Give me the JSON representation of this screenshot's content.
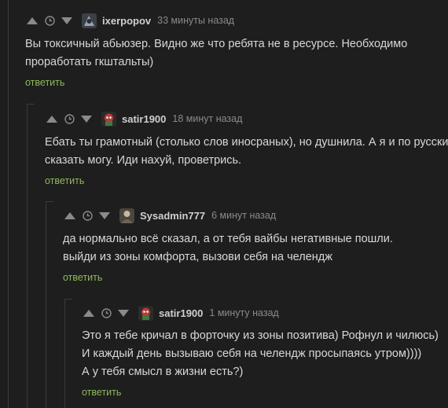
{
  "comments": [
    {
      "user": "ixerpopov",
      "time": "33 минуты назад",
      "lines": [
        "Вы токсичный абьюзер. Видно же что ребята не в ресурсе. Необходимо",
        "проработать гкштальты)"
      ],
      "reply": "ответить"
    },
    {
      "user": "satir1900",
      "time": "18 минут назад",
      "lines": [
        "Ебать ты грамотный (столько слов иносраных), но душнила. А я и по русски",
        "сказать могу. Иди нахуй, проветрись."
      ],
      "reply": "ответить"
    },
    {
      "user": "Sysadmin777",
      "time": "6 минут назад",
      "lines": [
        "да нормально всё сказал, а от тебя вайбы негативные пошли.",
        "выйди из зоны комфорта, вызови себя на челендж"
      ],
      "reply": "ответить"
    },
    {
      "user": "satir1900",
      "time": "1 минуту назад",
      "lines": [
        "Это я тебе кричал в форточку из зоны позитива) Рофнул и чилюсь)",
        "И каждый день вызываю себя на челендж просыпаясь утром))))",
        "А у тебя смысл в жизни есть?)"
      ],
      "reply": "ответить"
    }
  ],
  "colors": {
    "accent": "#8fb85a",
    "icon": "#8a8a8a",
    "background": "#1e1e1e"
  }
}
